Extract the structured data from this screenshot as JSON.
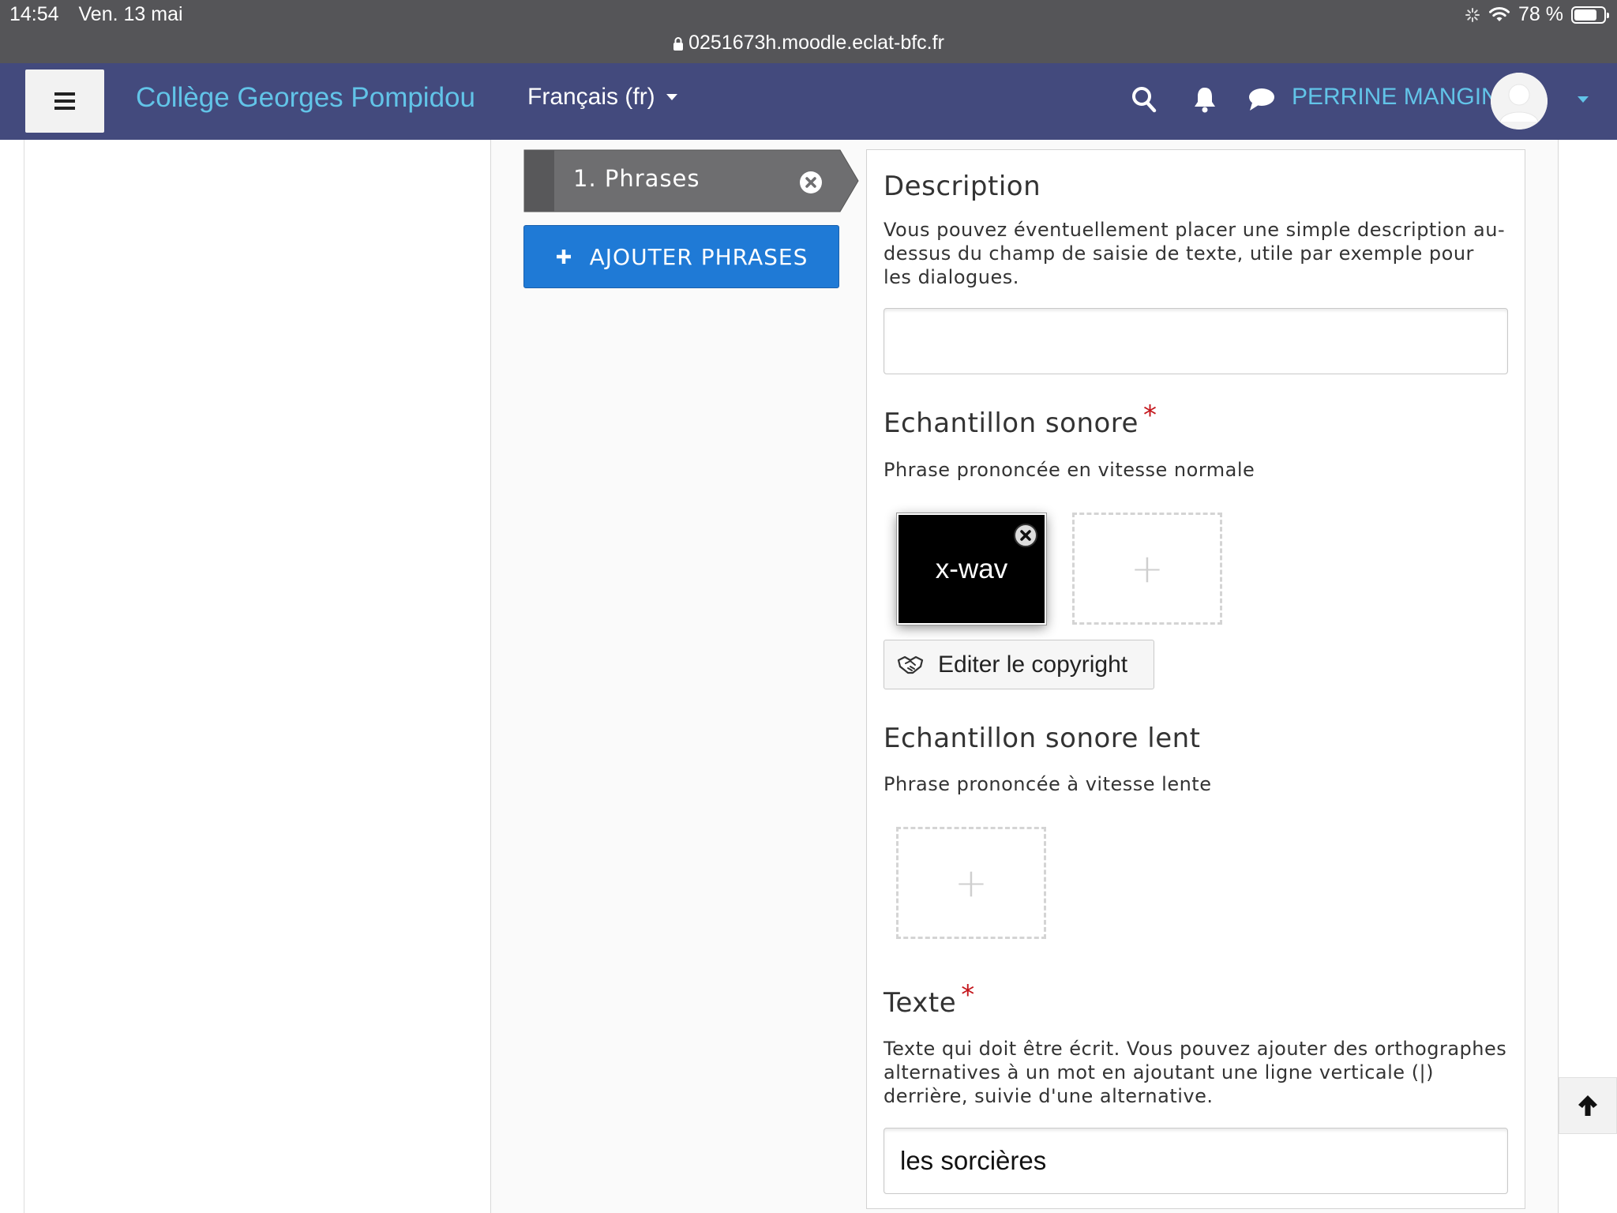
{
  "status_bar": {
    "time": "14:54",
    "date": "Ven. 13 mai",
    "battery": "78 %",
    "battery_level": 0.78,
    "url": "0251673h.moodle.eclat-bfc.fr"
  },
  "navbar": {
    "site_name": "Collège Georges Pompidou",
    "language": "Français (fr)",
    "user_name": "PERRINE MANGIN",
    "icons": [
      "menu-icon",
      "search-icon",
      "bell-icon",
      "chat-icon",
      "user-avatar"
    ]
  },
  "sidebar": {
    "tab_label": "1. Phrases",
    "add_button": "AJOUTER PHRASES"
  },
  "form": {
    "description": {
      "title": "Description",
      "help": "Vous pouvez éventuellement placer une simple description au-dessus du champ de saisie de texte, utile par exemple pour les dialogues.",
      "value": ""
    },
    "audio": {
      "title": "Echantillon sonore",
      "required_mark": "*",
      "help": "Phrase prononcée en vitesse normale",
      "file_label": "x-wav",
      "add_symbol": "+",
      "copyright_button": "Editer le copyright"
    },
    "audio_slow": {
      "title": "Echantillon sonore lent",
      "help": "Phrase prononcée à vitesse lente",
      "add_symbol": "+"
    },
    "text": {
      "title": "Texte",
      "required_mark": "*",
      "help": "Texte qui doit être écrit. Vous pouvez ajouter des orthographes alternatives à un mot en ajoutant une ligne verticale (|) derrière, suivie d'une alternative.",
      "value": "les sorcières"
    }
  },
  "colors": {
    "navbar": "#434a7d",
    "site_name": "#62c4e8",
    "primary_button": "#1f7ad6",
    "required": "#c4161c",
    "tab": "#6e6e70"
  }
}
